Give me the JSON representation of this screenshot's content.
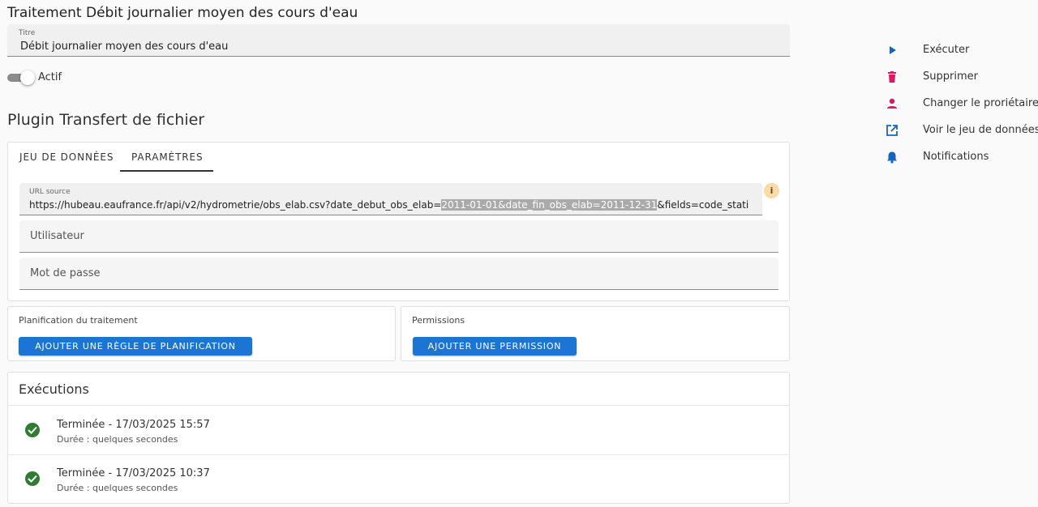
{
  "page": {
    "title": "Traitement Débit journalier moyen des cours d'eau"
  },
  "title_field": {
    "label": "Titre",
    "value": "Débit journalier moyen des cours d'eau"
  },
  "active_toggle": {
    "label": "Actif",
    "on": true
  },
  "plugin": {
    "title": "Plugin Transfert de fichier",
    "tabs": [
      {
        "label": "Jeu de données",
        "active": false
      },
      {
        "label": "Paramètres",
        "active": true
      }
    ],
    "url_field": {
      "label": "URL source",
      "value_pre": "https://hubeau.eaufrance.fr/api/v2/hydrometrie/obs_elab.csv?date_debut_obs_elab=",
      "value_selected": "2011-01-01&date_fin_obs_elab=2011-12-31",
      "value_post": "&fields=code_stati"
    },
    "user_field": {
      "placeholder": "Utilisateur"
    },
    "password_field": {
      "placeholder": "Mot de passe"
    }
  },
  "scheduling": {
    "label": "Planification du traitement",
    "button_label": "Ajouter une règle de planification"
  },
  "permissions": {
    "label": "Permissions",
    "button_label": "Ajouter une permission"
  },
  "executions": {
    "title": "Exécutions",
    "items": [
      {
        "status": "Terminée - 17/03/2025 15:57",
        "duration": "Durée : quelques secondes"
      },
      {
        "status": "Terminée - 17/03/2025 10:37",
        "duration": "Durée : quelques secondes"
      }
    ]
  },
  "side_actions": [
    {
      "label": "Exécuter",
      "icon": "play-icon",
      "color": "#1565c0"
    },
    {
      "label": "Supprimer",
      "icon": "trash-icon",
      "color": "#d81b60"
    },
    {
      "label": "Changer le proriétaire",
      "icon": "person-icon",
      "color": "#d81b60"
    },
    {
      "label": "Voir le jeu de données",
      "icon": "open-in-new-icon",
      "color": "#1565c0"
    },
    {
      "label": "Notifications",
      "icon": "bell-icon",
      "color": "#1565c0"
    }
  ],
  "colors": {
    "primary": "#1a76d2",
    "success": "#2e7d32",
    "danger": "#d81b60",
    "info_badge": "#fcd9a5"
  }
}
